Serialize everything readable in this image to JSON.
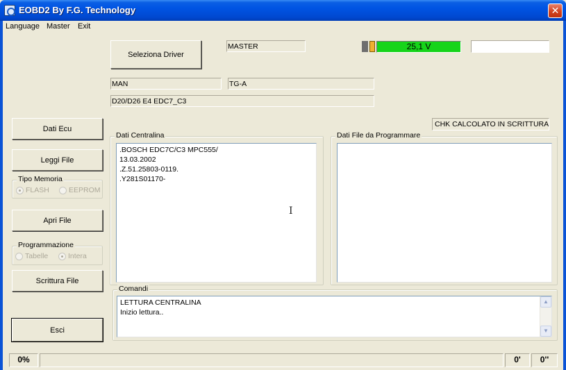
{
  "window": {
    "title": "EOBD2 By F.G. Technology",
    "close_label": "✕"
  },
  "menu": [
    "Language",
    "Master",
    "Exit"
  ],
  "header": {
    "seleziona_driver": "Seleziona Driver",
    "master_field": "MASTER",
    "voltage": "25,1 V",
    "right_field": "",
    "manufacturer": "MAN",
    "model": "TG-A",
    "engine": "D20/D26  E4  EDC7_C3",
    "chk_status": "CHK CALCOLATO IN SCRITTURA"
  },
  "left_panel": {
    "dati_ecu": "Dati Ecu",
    "leggi_file": "Leggi File",
    "tipo_memoria": {
      "label": "Tipo Memoria",
      "options": [
        {
          "label": "FLASH",
          "checked": true
        },
        {
          "label": "EEPROM",
          "checked": false
        }
      ]
    },
    "apri_file": "Apri File",
    "programmazione": {
      "label": "Programmazione",
      "options": [
        {
          "label": "Tabelle",
          "checked": false
        },
        {
          "label": "Intera",
          "checked": true
        }
      ]
    },
    "scrittura_file": "Scrittura File",
    "esci": "Esci"
  },
  "dati_centralina": {
    "label": "Dati Centralina",
    "lines": [
      ".BOSCH EDC7C/C3 MPC555/",
      "13.03.2002",
      ".Z.51.25803-0119.",
      ".Y281S01170-"
    ]
  },
  "dati_file": {
    "label": "Dati File da Programmare",
    "lines": []
  },
  "comandi": {
    "label": "Comandi",
    "lines": [
      "LETTURA CENTRALINA",
      "Inizio lettura.."
    ]
  },
  "statusbar": {
    "percent": "0%",
    "message": "",
    "minutes": "0'",
    "seconds": "0''"
  },
  "colors": {
    "voltage_ok": "#16d41a",
    "title_bar": "#0054e3"
  }
}
